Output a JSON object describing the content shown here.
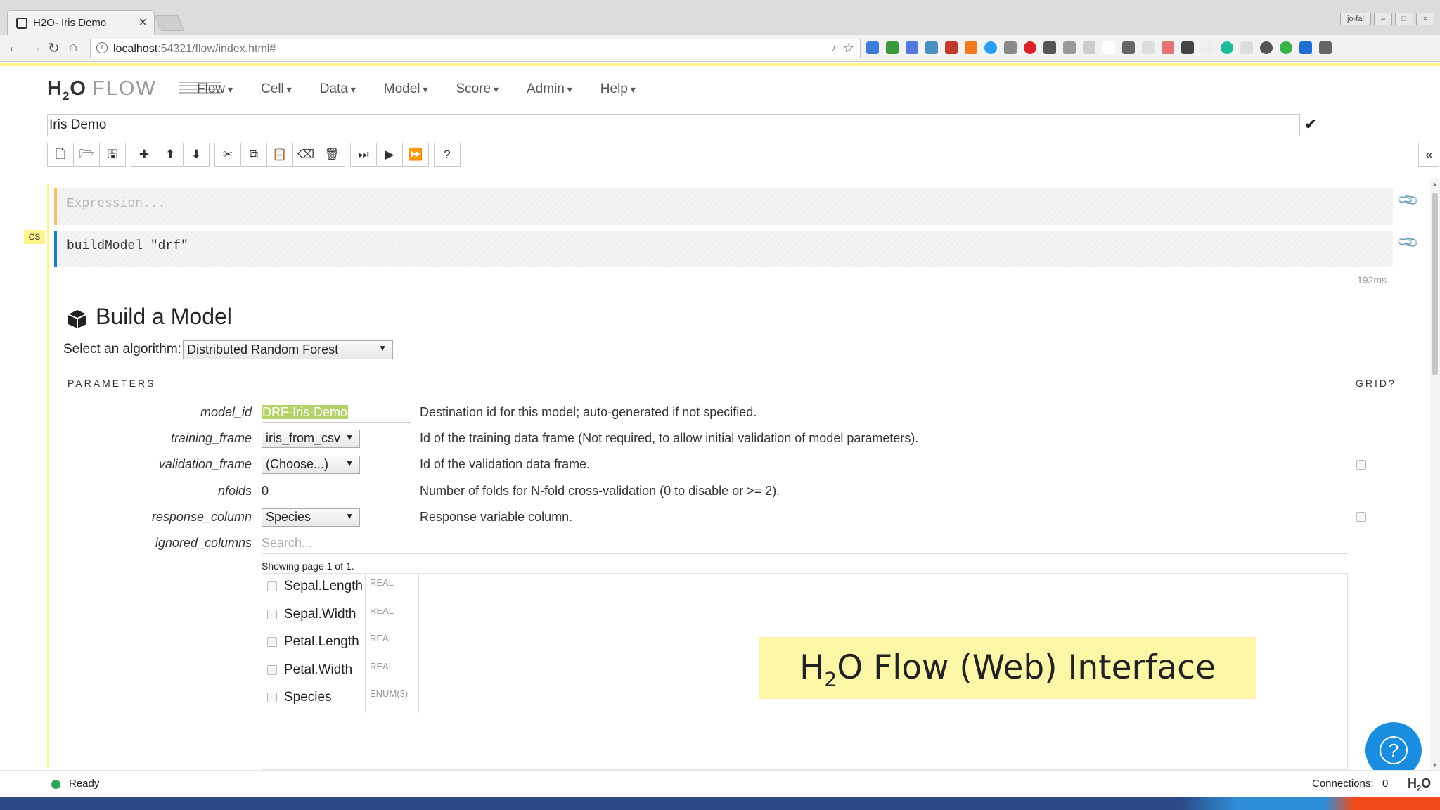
{
  "browser": {
    "tab_title": "H2O- Iris Demo",
    "tab_close": "×",
    "url_host": "localhost",
    "url_path": ":54321/flow/index.html#",
    "window_badge": "jo-fal"
  },
  "app": {
    "logo_h": "H",
    "logo_2": "2",
    "logo_o": "O",
    "logo_flow": "FLOW",
    "menu": [
      "Flow",
      "Cell",
      "Data",
      "Model",
      "Score",
      "Admin",
      "Help"
    ],
    "flow_name": "Iris Demo"
  },
  "cells": {
    "expression_placeholder": "Expression...",
    "code": "buildModel \"drf\"",
    "cell_type": "CS",
    "timing": "192ms"
  },
  "build_model": {
    "title": "Build a Model",
    "algorithm_label": "Select an algorithm:",
    "algorithm_value": "Distributed Random Forest",
    "parameters_heading": "PARAMETERS",
    "grid_heading": "GRID?",
    "params": [
      {
        "name": "model_id",
        "value": "DRF-Iris-Demo",
        "description": "Destination id for this model; auto-generated if not specified."
      },
      {
        "name": "training_frame",
        "value": "iris_from_csv",
        "description": "Id of the training data frame (Not required, to allow initial validation of model parameters)."
      },
      {
        "name": "validation_frame",
        "value": "(Choose...)",
        "description": "Id of the validation data frame."
      },
      {
        "name": "nfolds",
        "value": "0",
        "description": "Number of folds for N-fold cross-validation (0 to disable or >= 2)."
      },
      {
        "name": "response_column",
        "value": "Species",
        "description": "Response variable column."
      },
      {
        "name": "ignored_columns",
        "value": "",
        "description": ""
      }
    ],
    "search_placeholder": "Search...",
    "page_info": "Showing page 1 of 1.",
    "columns": [
      {
        "name": "Sepal.Length",
        "type": "REAL"
      },
      {
        "name": "Sepal.Width",
        "type": "REAL"
      },
      {
        "name": "Petal.Length",
        "type": "REAL"
      },
      {
        "name": "Petal.Width",
        "type": "REAL"
      },
      {
        "name": "Species",
        "type": "ENUM(3)"
      }
    ]
  },
  "caption": {
    "pre": "H",
    "sub": "2",
    "post": "O Flow (Web) Interface"
  },
  "status": {
    "text": "Ready",
    "connections_label": "Connections:",
    "connections_value": "0",
    "logo_h": "H",
    "logo_2": "2",
    "logo_o": "O"
  },
  "colors": {
    "accent_yellow": "#fff38a",
    "selection_green": "#b5d16a",
    "help_blue": "#1a8de0",
    "status_green": "#2aa55a"
  }
}
